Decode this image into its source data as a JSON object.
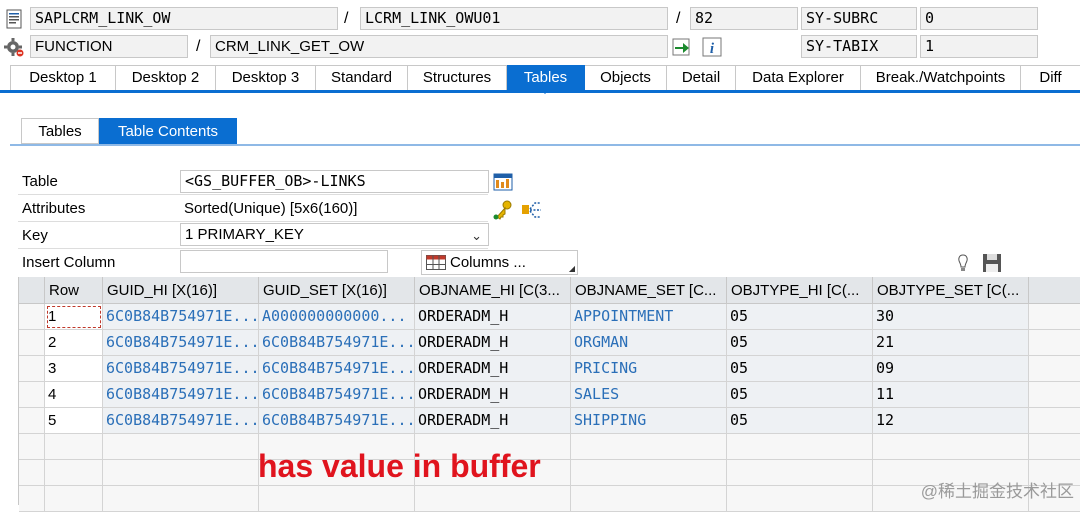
{
  "header": {
    "program": "SAPLCRM_LINK_OW",
    "include": "LCRM_LINK_OWU01",
    "line": "82",
    "var1_name": "SY-SUBRC",
    "var1_value": "0",
    "event_type": "FUNCTION",
    "event_name": "CRM_LINK_GET_OW",
    "var2_name": "SY-TABIX",
    "var2_value": "1",
    "sep": "/"
  },
  "tabs": [
    {
      "label": "Desktop 1"
    },
    {
      "label": "Desktop 2"
    },
    {
      "label": "Desktop 3"
    },
    {
      "label": "Standard"
    },
    {
      "label": "Structures"
    },
    {
      "label": "Tables",
      "active": true
    },
    {
      "label": "Objects"
    },
    {
      "label": "Detail"
    },
    {
      "label": "Data Explorer"
    },
    {
      "label": "Break./Watchpoints"
    },
    {
      "label": "Diff"
    }
  ],
  "subtabs": [
    {
      "label": "Tables"
    },
    {
      "label": "Table Contents",
      "active": true
    }
  ],
  "form": {
    "table_label": "Table",
    "table_value": "<GS_BUFFER_OB>-LINKS",
    "attributes_label": "Attributes",
    "attributes_value": "Sorted(Unique) [5x6(160)]",
    "key_label": "Key",
    "key_value": "1 PRIMARY_KEY",
    "insert_column_label": "Insert Column",
    "insert_column_value": "",
    "columns_button": "Columns ..."
  },
  "grid": {
    "headers": [
      "Row",
      "GUID_HI [X(16)]",
      "GUID_SET [X(16)]",
      "OBJNAME_HI [C(3...",
      "OBJNAME_SET [C...",
      "OBJTYPE_HI [C(...",
      "OBJTYPE_SET [C(..."
    ],
    "rows": [
      [
        "1",
        "6C0B84B754971E...",
        "A000000000000...",
        "ORDERADM_H",
        "APPOINTMENT",
        "05",
        "30"
      ],
      [
        "2",
        "6C0B84B754971E...",
        "6C0B84B754971E...",
        "ORDERADM_H",
        "ORGMAN",
        "05",
        "21"
      ],
      [
        "3",
        "6C0B84B754971E...",
        "6C0B84B754971E...",
        "ORDERADM_H",
        "PRICING",
        "05",
        "09"
      ],
      [
        "4",
        "6C0B84B754971E...",
        "6C0B84B754971E...",
        "ORDERADM_H",
        "SALES",
        "05",
        "11"
      ],
      [
        "5",
        "6C0B84B754971E...",
        "6C0B84B754971E...",
        "ORDERADM_H",
        "SHIPPING",
        "05",
        "12"
      ]
    ]
  },
  "annotation": "has value in buffer",
  "watermark": "@稀土掘金技术社区",
  "colors": {
    "accent": "#0a6ed1",
    "link": "#2a6fb8",
    "annotation": "#e0141e"
  }
}
